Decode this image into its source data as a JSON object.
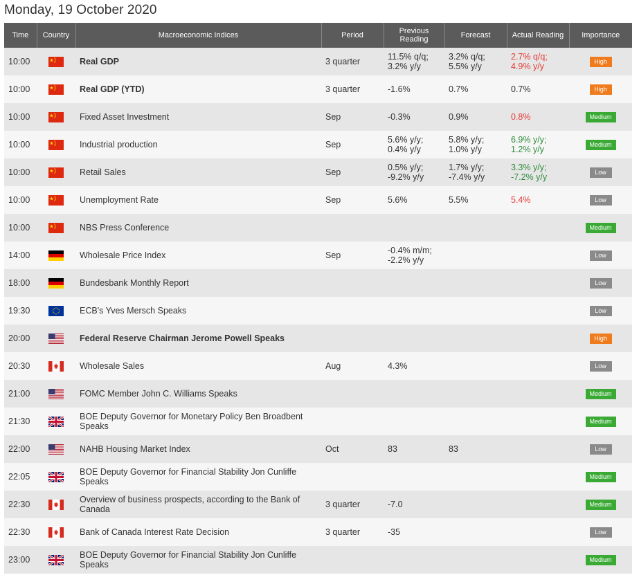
{
  "date_title": "Monday, 19 October 2020",
  "headers": {
    "time": "Time",
    "country": "Country",
    "event": "Macroeconomic Indices",
    "period": "Period",
    "previous": "Previous Reading",
    "forecast": "Forecast",
    "actual": "Actual Reading",
    "importance": "Importance"
  },
  "colors": {
    "high": "#f07b1d",
    "medium": "#3aaa35",
    "low": "#8a8a8a",
    "actual_above": "#2e8b3a",
    "actual_below": "#e53935"
  },
  "rows": [
    {
      "time": "10:00",
      "flag": "china-flag",
      "event": "Real GDP",
      "bold": true,
      "period": "3 quarter",
      "previous": "11.5% q/q;\n3.2% y/y",
      "forecast": "3.2% q/q;\n5.5% y/y",
      "actual": "2.7% q/q;\n4.9% y/y",
      "actual_color": "red",
      "importance": "High"
    },
    {
      "time": "10:00",
      "flag": "china-flag",
      "event": "Real GDP (YTD)",
      "bold": true,
      "period": "3 quarter",
      "previous": "-1.6%",
      "forecast": "0.7%",
      "actual": "0.7%",
      "actual_color": "",
      "importance": "High"
    },
    {
      "time": "10:00",
      "flag": "china-flag",
      "event": "Fixed Asset Investment",
      "bold": false,
      "period": "Sep",
      "previous": "-0.3%",
      "forecast": "0.9%",
      "actual": "0.8%",
      "actual_color": "red",
      "importance": "Medium"
    },
    {
      "time": "10:00",
      "flag": "china-flag",
      "event": "Industrial production",
      "bold": false,
      "period": "Sep",
      "previous": "5.6% y/y;\n0.4% y/y",
      "forecast": "5.8% y/y;\n1.0% y/y",
      "actual": "6.9% y/y;\n1.2% y/y",
      "actual_color": "green",
      "importance": "Medium"
    },
    {
      "time": "10:00",
      "flag": "china-flag",
      "event": "Retail Sales",
      "bold": false,
      "period": "Sep",
      "previous": "0.5% y/y;\n-9.2% y/y",
      "forecast": "1.7% y/y;\n-7.4% y/y",
      "actual": "3.3% y/y;\n-7.2% y/y",
      "actual_color": "green",
      "importance": "Low"
    },
    {
      "time": "10:00",
      "flag": "china-flag",
      "event": "Unemployment Rate",
      "bold": false,
      "period": "Sep",
      "previous": "5.6%",
      "forecast": "5.5%",
      "actual": "5.4%",
      "actual_color": "red",
      "importance": "Low"
    },
    {
      "time": "10:00",
      "flag": "china-flag",
      "event": "NBS Press Conference",
      "bold": false,
      "period": "",
      "previous": "",
      "forecast": "",
      "actual": "",
      "actual_color": "",
      "importance": "Medium"
    },
    {
      "time": "14:00",
      "flag": "germany-flag",
      "event": "Wholesale Price Index",
      "bold": false,
      "period": "Sep",
      "previous": "-0.4% m/m;\n-2.2% y/y",
      "forecast": "",
      "actual": "",
      "actual_color": "",
      "importance": "Low"
    },
    {
      "time": "18:00",
      "flag": "germany-flag",
      "event": "Bundesbank Monthly Report",
      "bold": false,
      "period": "",
      "previous": "",
      "forecast": "",
      "actual": "",
      "actual_color": "",
      "importance": "Low"
    },
    {
      "time": "19:30",
      "flag": "eu-flag",
      "event": "ECB's Yves Mersch Speaks",
      "bold": false,
      "period": "",
      "previous": "",
      "forecast": "",
      "actual": "",
      "actual_color": "",
      "importance": "Low"
    },
    {
      "time": "20:00",
      "flag": "usa-flag",
      "event": "Federal Reserve Chairman Jerome Powell Speaks",
      "bold": true,
      "period": "",
      "previous": "",
      "forecast": "",
      "actual": "",
      "actual_color": "",
      "importance": "High"
    },
    {
      "time": "20:30",
      "flag": "canada-flag",
      "event": "Wholesale Sales",
      "bold": false,
      "period": "Aug",
      "previous": "4.3%",
      "forecast": "",
      "actual": "",
      "actual_color": "",
      "importance": "Low"
    },
    {
      "time": "21:00",
      "flag": "usa-flag",
      "event": "FOMC Member John C. Williams Speaks",
      "bold": false,
      "period": "",
      "previous": "",
      "forecast": "",
      "actual": "",
      "actual_color": "",
      "importance": "Medium"
    },
    {
      "time": "21:30",
      "flag": "uk-flag",
      "event": "BOE Deputy Governor for Monetary Policy Ben Broadbent Speaks",
      "bold": false,
      "period": "",
      "previous": "",
      "forecast": "",
      "actual": "",
      "actual_color": "",
      "importance": "Medium"
    },
    {
      "time": "22:00",
      "flag": "usa-flag",
      "event": "NAHB Housing Market Index",
      "bold": false,
      "period": "Oct",
      "previous": "83",
      "forecast": "83",
      "actual": "",
      "actual_color": "",
      "importance": "Low"
    },
    {
      "time": "22:05",
      "flag": "uk-flag",
      "event": "BOE Deputy Governor for Financial Stability Jon Cunliffe Speaks",
      "bold": false,
      "period": "",
      "previous": "",
      "forecast": "",
      "actual": "",
      "actual_color": "",
      "importance": "Medium"
    },
    {
      "time": "22:30",
      "flag": "canada-flag",
      "event": "Overview of business prospects, according to the Bank of Canada",
      "bold": false,
      "period": "3 quarter",
      "previous": "-7.0",
      "forecast": "",
      "actual": "",
      "actual_color": "",
      "importance": "Medium"
    },
    {
      "time": "22:30",
      "flag": "canada-flag",
      "event": "Bank of Canada Interest Rate Decision",
      "bold": false,
      "period": "3 quarter",
      "previous": "-35",
      "forecast": "",
      "actual": "",
      "actual_color": "",
      "importance": "Low"
    },
    {
      "time": "23:00",
      "flag": "uk-flag",
      "event": "BOE Deputy Governor for Financial Stability Jon Cunliffe Speaks",
      "bold": false,
      "period": "",
      "previous": "",
      "forecast": "",
      "actual": "",
      "actual_color": "",
      "importance": "Medium"
    }
  ]
}
